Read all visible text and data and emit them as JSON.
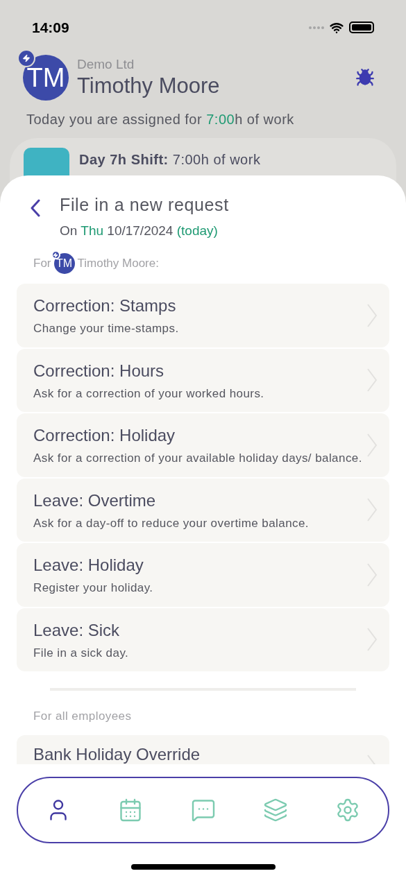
{
  "status_bar": {
    "time": "14:09"
  },
  "header": {
    "company": "Demo Ltd",
    "name": "Timothy Moore",
    "initials": "TM"
  },
  "assigned": {
    "before": "Today you are assigned for",
    "hours": "7:00",
    "after": "h of work"
  },
  "shift": {
    "title": "Day 7h Shift:",
    "detail": "7:00h of work"
  },
  "sheet": {
    "title": "File in a new request",
    "date_prefix": "On",
    "weekday": "Thu",
    "date": "10/17/2024",
    "today": "(today)",
    "for_label": "For",
    "for_initials": "TM",
    "for_name": "Timothy Moore:",
    "requests": [
      {
        "title": "Correction: Stamps",
        "subtitle": "Change your time-stamps."
      },
      {
        "title": "Correction: Hours",
        "subtitle": "Ask for a correction of your worked hours."
      },
      {
        "title": "Correction: Holiday",
        "subtitle": "Ask for a correction of your available holiday days/ balance."
      },
      {
        "title": "Leave: Overtime",
        "subtitle": "Ask for a day-off to reduce your overtime balance."
      },
      {
        "title": "Leave: Holiday",
        "subtitle": "Register your holiday."
      },
      {
        "title": "Leave: Sick",
        "subtitle": "File in a sick day."
      }
    ],
    "all_label": "For all employees",
    "all_requests": [
      {
        "title": "Bank Holiday Override"
      }
    ]
  },
  "tab_bar": [
    {
      "selected": true
    },
    {
      "selected": false
    },
    {
      "selected": false
    },
    {
      "selected": false
    },
    {
      "selected": false
    }
  ]
}
